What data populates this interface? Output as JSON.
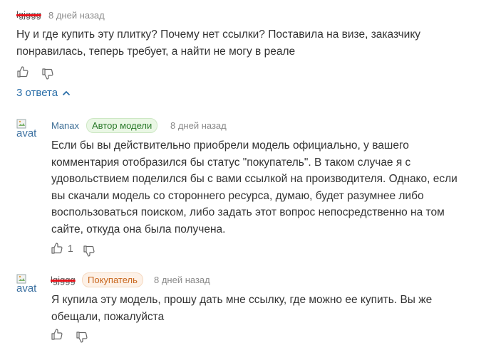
{
  "comment": {
    "username": "lgjggg",
    "time": "8 дней назад",
    "text_line1": "Ну и где купить эту плитку? Почему нет ссылки? Поставила на визе, заказчику",
    "text_line2": "понравилась, теперь требует, а найти не могу в реале"
  },
  "replies_toggle": {
    "label": "3 ответа"
  },
  "reply1": {
    "avatar_alt": "avat",
    "username": "Manax",
    "badge": "Автор модели",
    "time": "8 дней назад",
    "lines": [
      "Если бы вы действительно приобрели модель официально, у вашего",
      "комментария отобразился бы статус \"покупатель\". В таком случае я с",
      "удовольствием поделился бы с вами ссылкой на производителя. Однако, если",
      "вы скачали модель со стороннего ресурса, думаю, будет разумнее либо",
      "воспользоваться поиском, либо задать этот вопрос непосредственно на том",
      "сайте, откуда она была получена."
    ],
    "likes": "1"
  },
  "reply2": {
    "avatar_alt": "avat",
    "username": "lgjggg",
    "badge": "Покупатель",
    "time": "8 дней назад",
    "line1": "Я купила эту модель, прошу дать мне ссылку, где можно ее купить. Вы же",
    "line2": "обещали, пожалуйста"
  },
  "colors": {
    "link": "#2a6ea8",
    "author_badge_bg": "#eaf7e5",
    "buyer_badge_bg": "#fdf1e7",
    "redaction": "#e8131b"
  },
  "icons": [
    "thumbs-up-icon",
    "thumbs-down-icon",
    "chevron-up-icon",
    "broken-image-icon"
  ]
}
